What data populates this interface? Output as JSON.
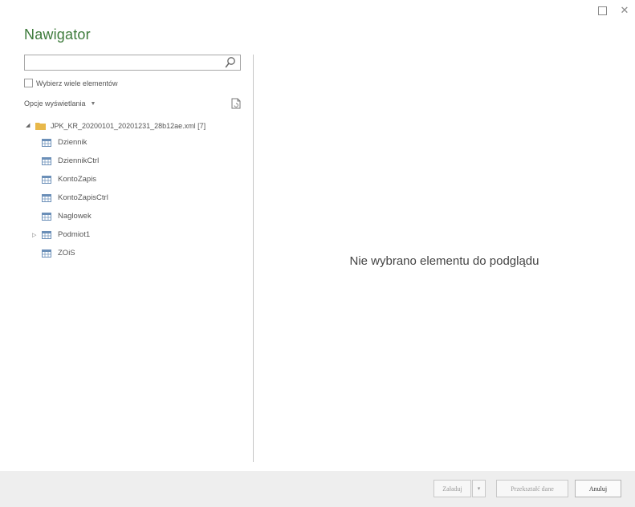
{
  "window": {
    "title": "Nawigator",
    "controls": {
      "maximize_label": "",
      "close_label": "✕"
    }
  },
  "left_pane": {
    "search": {
      "value": "",
      "placeholder": ""
    },
    "multi_select_label": "Wybierz wiele elementów",
    "display_options_label": "Opcje wyświetlania",
    "tree": {
      "root_label": "JPK_KR_20200101_20201231_28b12ae.xml [7]",
      "items": [
        {
          "label": "Dziennik",
          "expandable": false
        },
        {
          "label": "DziennikCtrl",
          "expandable": false
        },
        {
          "label": "KontoZapis",
          "expandable": false
        },
        {
          "label": "KontoZapisCtrl",
          "expandable": false
        },
        {
          "label": "Naglowek",
          "expandable": false
        },
        {
          "label": "Podmiot1",
          "expandable": true
        },
        {
          "label": "ZOiS",
          "expandable": false
        }
      ]
    }
  },
  "preview": {
    "empty_message": "Nie wybrano elementu do podglądu"
  },
  "footer": {
    "load_label": "Załaduj",
    "load_dropdown_label": "▾",
    "transform_label": "Przekształć dane",
    "cancel_label": "Anuluj"
  },
  "colors": {
    "title": "#3c7a3a",
    "folder": "#e8b84a",
    "table_icon": "#6b8fb8",
    "footer_bg": "#eeeeee"
  }
}
